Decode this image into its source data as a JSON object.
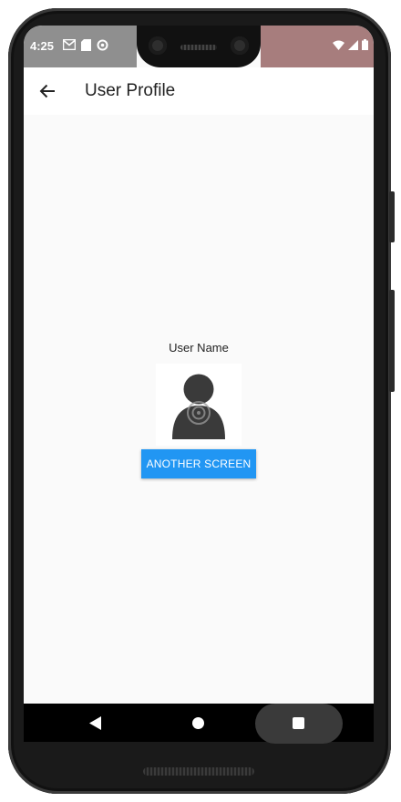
{
  "status_bar": {
    "time": "4:25",
    "left_icons": [
      "gmail-icon",
      "sd-card-icon",
      "sync-icon"
    ],
    "right_icons": [
      "wifi-icon",
      "signal-icon",
      "battery-icon"
    ]
  },
  "app_bar": {
    "title": "User Profile",
    "back_icon": "arrow-back-icon"
  },
  "profile": {
    "user_name": "User Name",
    "avatar_icon": "person-icon"
  },
  "actions": {
    "another_screen_label": "ANOTHER SCREEN"
  },
  "nav_bar": {
    "icons": [
      "nav-back-icon",
      "nav-home-icon",
      "nav-recents-icon"
    ]
  },
  "colors": {
    "primary": "#2196f3",
    "background": "#fafafa",
    "app_bar": "#ffffff"
  }
}
